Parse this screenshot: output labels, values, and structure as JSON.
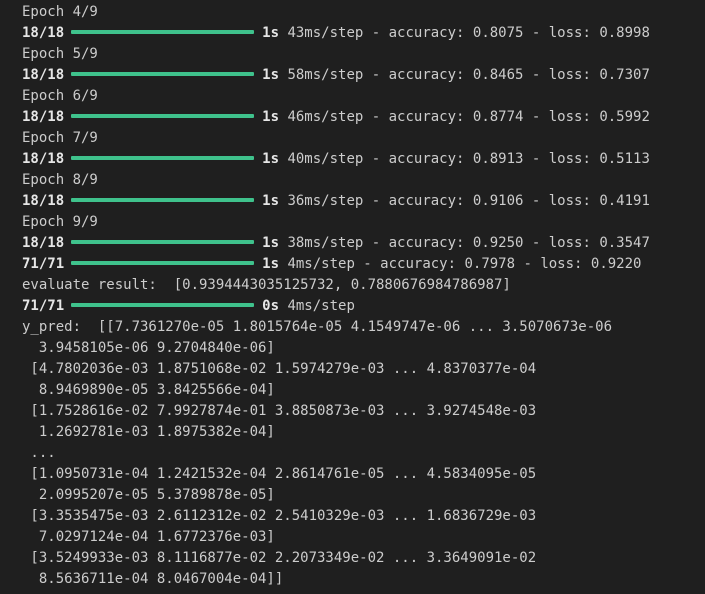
{
  "epochs": [
    {
      "label": "Epoch 4/9",
      "steps": "18/18",
      "time": "1s",
      "rest": "43ms/step - accuracy: 0.8075 - loss: 0.8998"
    },
    {
      "label": "Epoch 5/9",
      "steps": "18/18",
      "time": "1s",
      "rest": "58ms/step - accuracy: 0.8465 - loss: 0.7307"
    },
    {
      "label": "Epoch 6/9",
      "steps": "18/18",
      "time": "1s",
      "rest": "46ms/step - accuracy: 0.8774 - loss: 0.5992"
    },
    {
      "label": "Epoch 7/9",
      "steps": "18/18",
      "time": "1s",
      "rest": "40ms/step - accuracy: 0.8913 - loss: 0.5113"
    },
    {
      "label": "Epoch 8/9",
      "steps": "18/18",
      "time": "1s",
      "rest": "36ms/step - accuracy: 0.9106 - loss: 0.4191"
    },
    {
      "label": "Epoch 9/9",
      "steps": "18/18",
      "time": "1s",
      "rest": "38ms/step - accuracy: 0.9250 - loss: 0.3547"
    }
  ],
  "evaluate_progress": {
    "steps": "71/71",
    "time": "1s",
    "rest": "4ms/step - accuracy: 0.7978 - loss: 0.9220"
  },
  "evaluate_result": "evaluate result:  [0.9394443035125732, 0.7880676984786987]",
  "predict_progress": {
    "steps": "71/71",
    "time": "0s",
    "rest": "4ms/step"
  },
  "y_pred_lines": [
    "y_pred:  [[7.7361270e-05 1.8015764e-05 4.1549747e-06 ... 3.5070673e-06",
    "  3.9458105e-06 9.2704840e-06]",
    " [4.7802036e-03 1.8751068e-02 1.5974279e-03 ... 4.8370377e-04",
    "  8.9469890e-05 3.8425566e-04]",
    " [1.7528616e-02 7.9927874e-01 3.8850873e-03 ... 3.9274548e-03",
    "  1.2692781e-03 1.8975382e-04]",
    " ...",
    " [1.0950731e-04 1.2421532e-04 2.8614761e-05 ... 4.5834095e-05",
    "  2.0995207e-05 5.3789878e-05]",
    " [3.3535475e-03 2.6112312e-02 2.5410329e-03 ... 1.6836729e-03",
    "  7.0297124e-04 1.6772376e-03]",
    " [3.5249933e-03 8.1116877e-02 2.2073349e-02 ... 3.3649091e-02",
    "  8.5636711e-04 8.0467004e-04]]"
  ],
  "progress_fraction": 1.0,
  "colors": {
    "bar": "#3fc28c",
    "background": "#1f1f1f",
    "text": "#cccccc"
  }
}
